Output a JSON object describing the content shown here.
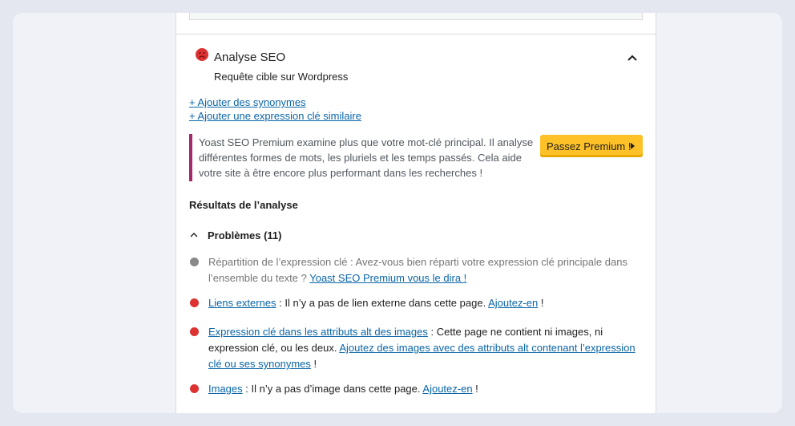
{
  "seo": {
    "title": "Analyse SEO",
    "subtitle": "Requête cible sur Wordpress",
    "status_icon": "sad-face-icon",
    "status_color": "#dc3232",
    "collapse_icon": "chevron-up-icon"
  },
  "links": {
    "synonyms": "+ Ajouter des synonymes",
    "similar_keyphrase": "+ Ajouter une expression clé similaire"
  },
  "premium": {
    "text": "Yoast SEO Premium examine plus que votre mot-clé principal. Il analyse différentes formes de mots, les pluriels et les temps passés. Cela aide votre site à être encore plus performant dans les recherches !",
    "button_label": "Passez Premium !",
    "bar_color": "#a4286a",
    "button_color": "#fec228"
  },
  "results": {
    "title": "Résultats de l’analyse",
    "problems_label": "Problèmes (11)",
    "items": [
      {
        "bullet_color": "#888888",
        "text": "Répartition de l’expression clé : Avez-vous bien réparti votre expression clé principale dans l’ensemble du texte ? ",
        "link": "Yoast SEO Premium vous le dira !"
      },
      {
        "bullet_color": "#dc3232",
        "link1": "Liens externes",
        "text1": " : Il n’y a pas de lien externe dans cette page. ",
        "link2": "Ajoutez-en",
        "text2": " !"
      },
      {
        "bullet_color": "#dc3232",
        "link1": "Expression clé dans les attributs alt des images",
        "text1": " : Cette page ne contient ni images, ni expression clé, ou les deux. ",
        "link2": "Ajoutez des images avec des attributs alt contenant l’expression clé ou ses synonymes",
        "text2": " !"
      },
      {
        "bullet_color": "#dc3232",
        "link1": "Images",
        "text1": " : Il n’y a pas d’image dans cette page. ",
        "link2": "Ajoutez-en",
        "text2": " !"
      }
    ]
  }
}
